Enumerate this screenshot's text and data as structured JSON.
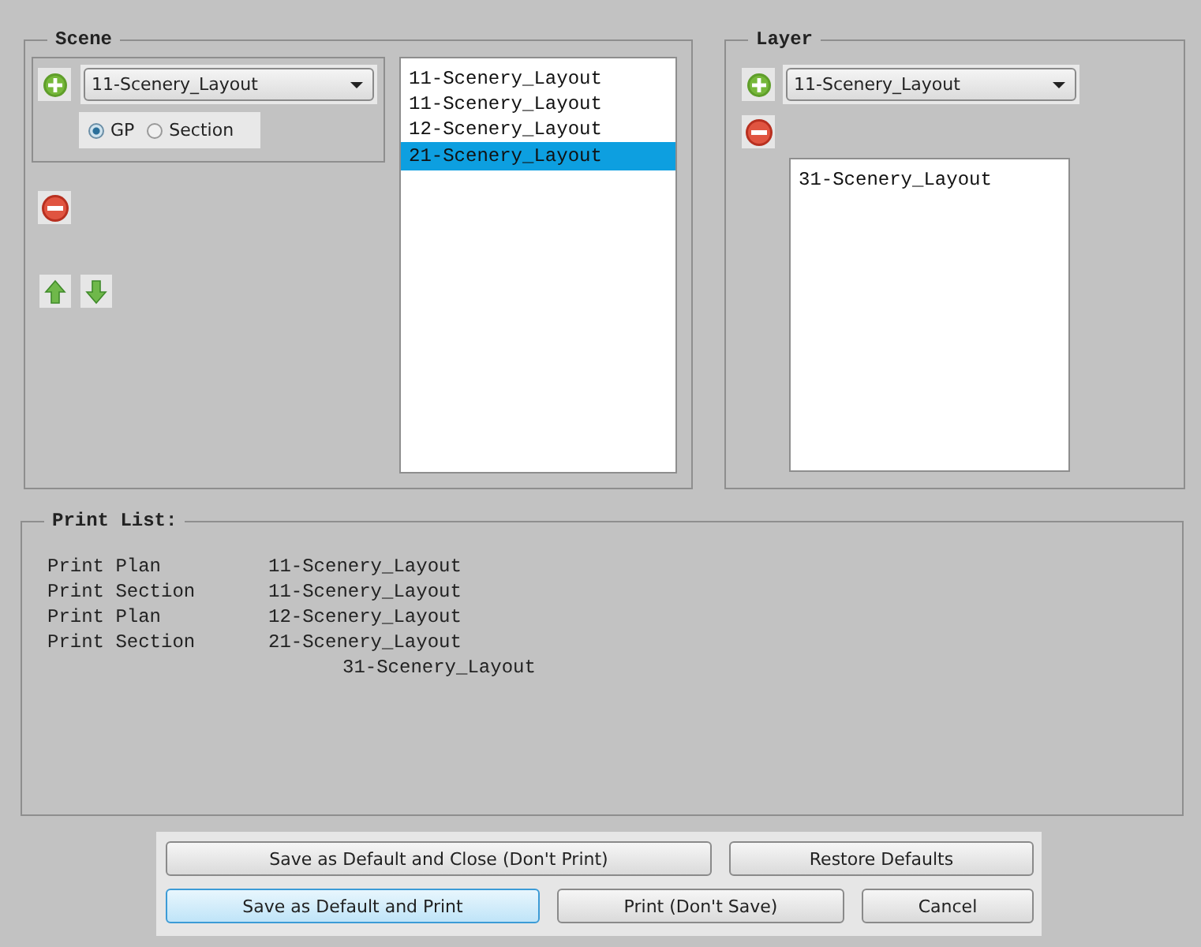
{
  "scene": {
    "title": "Scene",
    "dropdown": {
      "value": "11-Scenery_Layout"
    },
    "view_options": [
      {
        "label": "GP",
        "selected": true
      },
      {
        "label": "Section",
        "selected": false
      }
    ],
    "list": [
      {
        "label": "11-Scenery_Layout",
        "selected": false
      },
      {
        "label": "11-Scenery_Layout",
        "selected": false
      },
      {
        "label": "12-Scenery_Layout",
        "selected": false
      },
      {
        "label": "21-Scenery_Layout",
        "selected": true
      }
    ]
  },
  "layer": {
    "title": "Layer",
    "dropdown": {
      "value": "11-Scenery_Layout"
    },
    "list": [
      {
        "label": "31-Scenery_Layout",
        "selected": false
      }
    ]
  },
  "print_list": {
    "title": "Print List:",
    "rows": [
      {
        "kind": "entry",
        "action": "Print Plan",
        "layout": "11-Scenery_Layout"
      },
      {
        "kind": "entry",
        "action": "Print Section",
        "layout": "11-Scenery_Layout"
      },
      {
        "kind": "entry",
        "action": "Print Plan",
        "layout": "12-Scenery_Layout"
      },
      {
        "kind": "entry",
        "action": "Print Section",
        "layout": "21-Scenery_Layout"
      },
      {
        "kind": "layer",
        "layout": "31-Scenery_Layout"
      }
    ]
  },
  "buttons": [
    [
      {
        "label": "Save as Default and Close (Don't Print)",
        "default": false
      },
      {
        "label": "Restore Defaults",
        "default": false
      }
    ],
    [
      {
        "label": "Save as Default and Print",
        "default": true
      },
      {
        "label": "Print (Don't Save)",
        "default": false
      },
      {
        "label": "Cancel",
        "default": false
      }
    ]
  ]
}
